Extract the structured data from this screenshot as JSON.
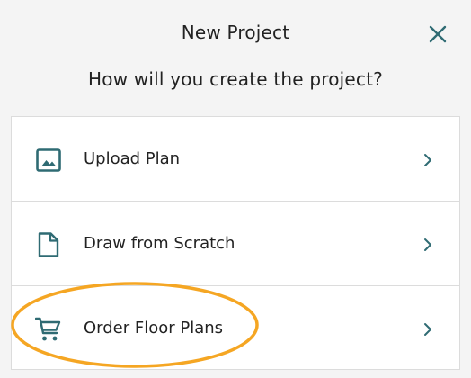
{
  "dialog": {
    "title": "New Project",
    "prompt": "How will you create the project?",
    "close_icon": "close-icon"
  },
  "options": [
    {
      "label": "Upload Plan",
      "icon": "image-icon"
    },
    {
      "label": "Draw from Scratch",
      "icon": "document-icon"
    },
    {
      "label": "Order Floor Plans",
      "icon": "cart-icon"
    }
  ],
  "colors": {
    "icon": "#2f6b73",
    "highlight": "#f5a623",
    "background": "#f4f4f4",
    "card": "#ffffff",
    "divider": "#dcdcdc"
  }
}
